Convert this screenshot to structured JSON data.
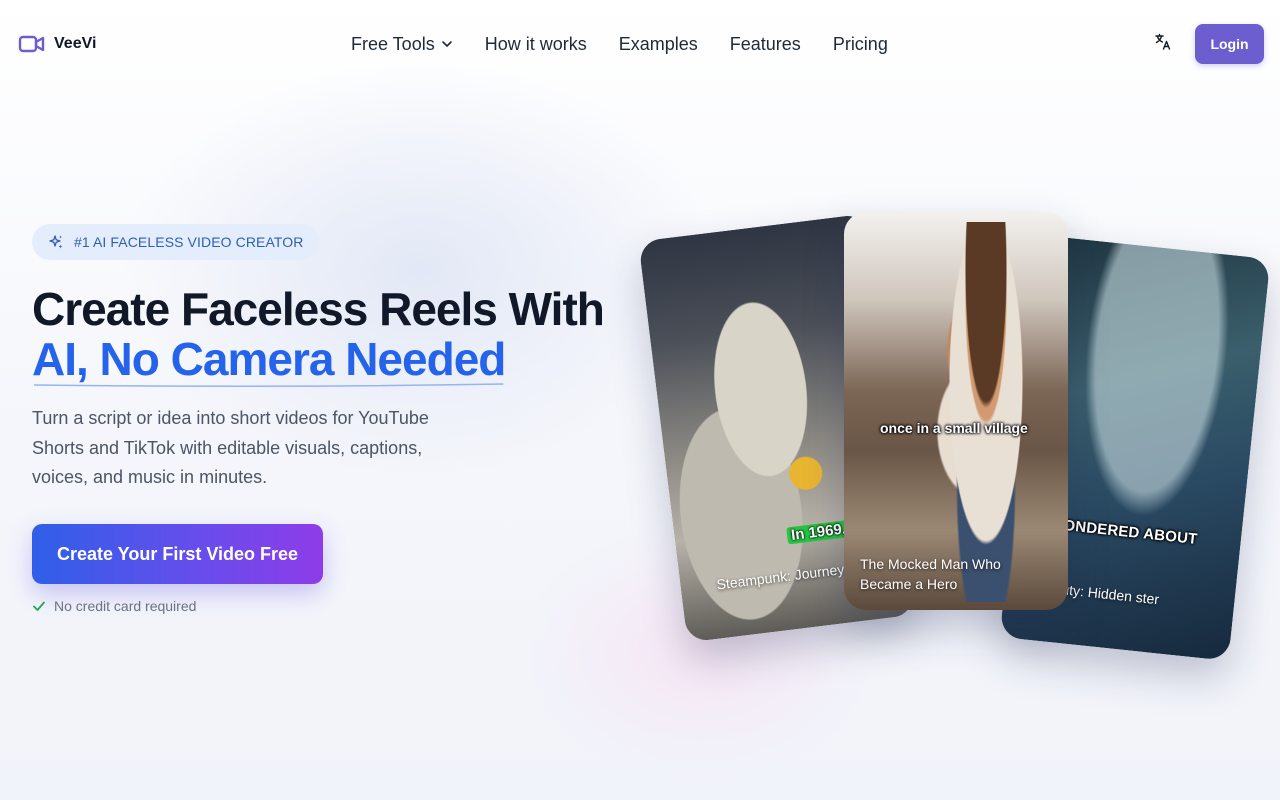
{
  "brand": {
    "name": "VeeVi",
    "accent": "#6c5ecf",
    "logo_icon": "video-camera-icon"
  },
  "nav": {
    "items": [
      {
        "label": "Free Tools",
        "has_dropdown": true
      },
      {
        "label": "How it works"
      },
      {
        "label": "Examples"
      },
      {
        "label": "Features"
      },
      {
        "label": "Pricing"
      }
    ],
    "language_icon": "translate-icon",
    "login_label": "Login"
  },
  "hero": {
    "badge": "#1 AI FACELESS VIDEO CREATOR",
    "badge_icon": "sparkles-icon",
    "title_line1": "Create Faceless Reels With",
    "title_line2": "AI, No Camera Needed",
    "subtitle": "Turn a script or idea into short videos for YouTube Shorts and TikTok with editable visuals, captions, voices, and music in minutes.",
    "cta_label": "Create Your First Video Free",
    "note": "No credit card required",
    "note_icon": "check-icon",
    "title_color": "#2563eb"
  },
  "cards": [
    {
      "caption": "Steampunk: Journey Moon",
      "overlay": "In 1969,"
    },
    {
      "caption": "The Mocked Man Who Became a Hero",
      "overlay": "once in a small village"
    },
    {
      "caption": "t Beauty: Hidden ster",
      "overlay": "ONDERED ABOUT"
    }
  ]
}
